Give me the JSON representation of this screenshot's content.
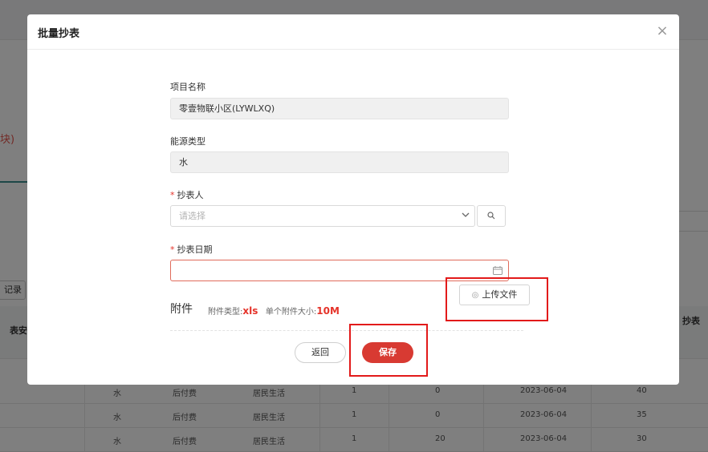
{
  "background": {
    "left_text": "块)",
    "left_button": "记录",
    "left_header": "表安",
    "right_header": "抄表",
    "rows": [
      {
        "c1": "水",
        "c2": "后付费",
        "c3": "居民生活",
        "c4": "1",
        "c5": "0",
        "c6": "2023-06-04",
        "c7": "40"
      },
      {
        "c1": "水",
        "c2": "后付费",
        "c3": "居民生活",
        "c4": "1",
        "c5": "0",
        "c6": "2023-06-04",
        "c7": "35"
      },
      {
        "c1": "水",
        "c2": "后付费",
        "c3": "居民生活",
        "c4": "1",
        "c5": "20",
        "c6": "2023-06-04",
        "c7": "30"
      }
    ]
  },
  "modal": {
    "title": "批量抄表",
    "close_icon": "close-icon",
    "fields": {
      "project_label": "项目名称",
      "project_value": "零壹物联小区(LYWLXQ)",
      "energy_label": "能源类型",
      "energy_value": "水",
      "reader_label": "抄表人",
      "reader_placeholder": "请选择",
      "date_label": "抄表日期",
      "date_value": ""
    },
    "attachment": {
      "title": "附件",
      "type_prefix": "附件类型:",
      "type_value": "xls",
      "size_prefix": "单个附件大小:",
      "size_value": "10M",
      "upload_label": "上传文件"
    },
    "buttons": {
      "back": "返回",
      "save": "保存"
    },
    "colors": {
      "primary": "#d83a32",
      "highlight_box": "#e21a1a",
      "required": "#e5332a"
    }
  }
}
